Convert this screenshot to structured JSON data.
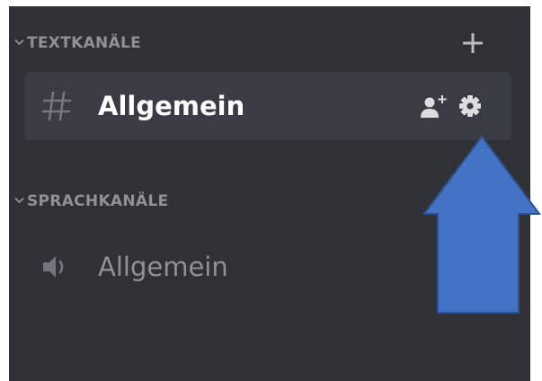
{
  "colors": {
    "panel_bg": "#2f3136",
    "selected_bg": "#393c43",
    "muted_text": "#8e9297",
    "active_text": "#ffffff",
    "icon": "#b9bbbe",
    "arrow_fill": "#4472c4",
    "arrow_stroke": "#2f528f"
  },
  "text_categories": {
    "label": "TEXTKANÄLE",
    "chevron_icon": "chevron-down-icon",
    "add_icon": "plus-icon",
    "channels": [
      {
        "name": "Allgemein",
        "icon": "hash-icon",
        "selected": true,
        "actions": [
          "invite-member-icon",
          "gear-icon"
        ]
      }
    ]
  },
  "voice_categories": {
    "label": "SPRACHKANÄLE",
    "chevron_icon": "chevron-down-icon",
    "channels": [
      {
        "name": "Allgemein",
        "icon": "speaker-icon"
      }
    ]
  },
  "annotation": {
    "type": "arrow",
    "direction": "up",
    "points_to": "gear-icon"
  }
}
